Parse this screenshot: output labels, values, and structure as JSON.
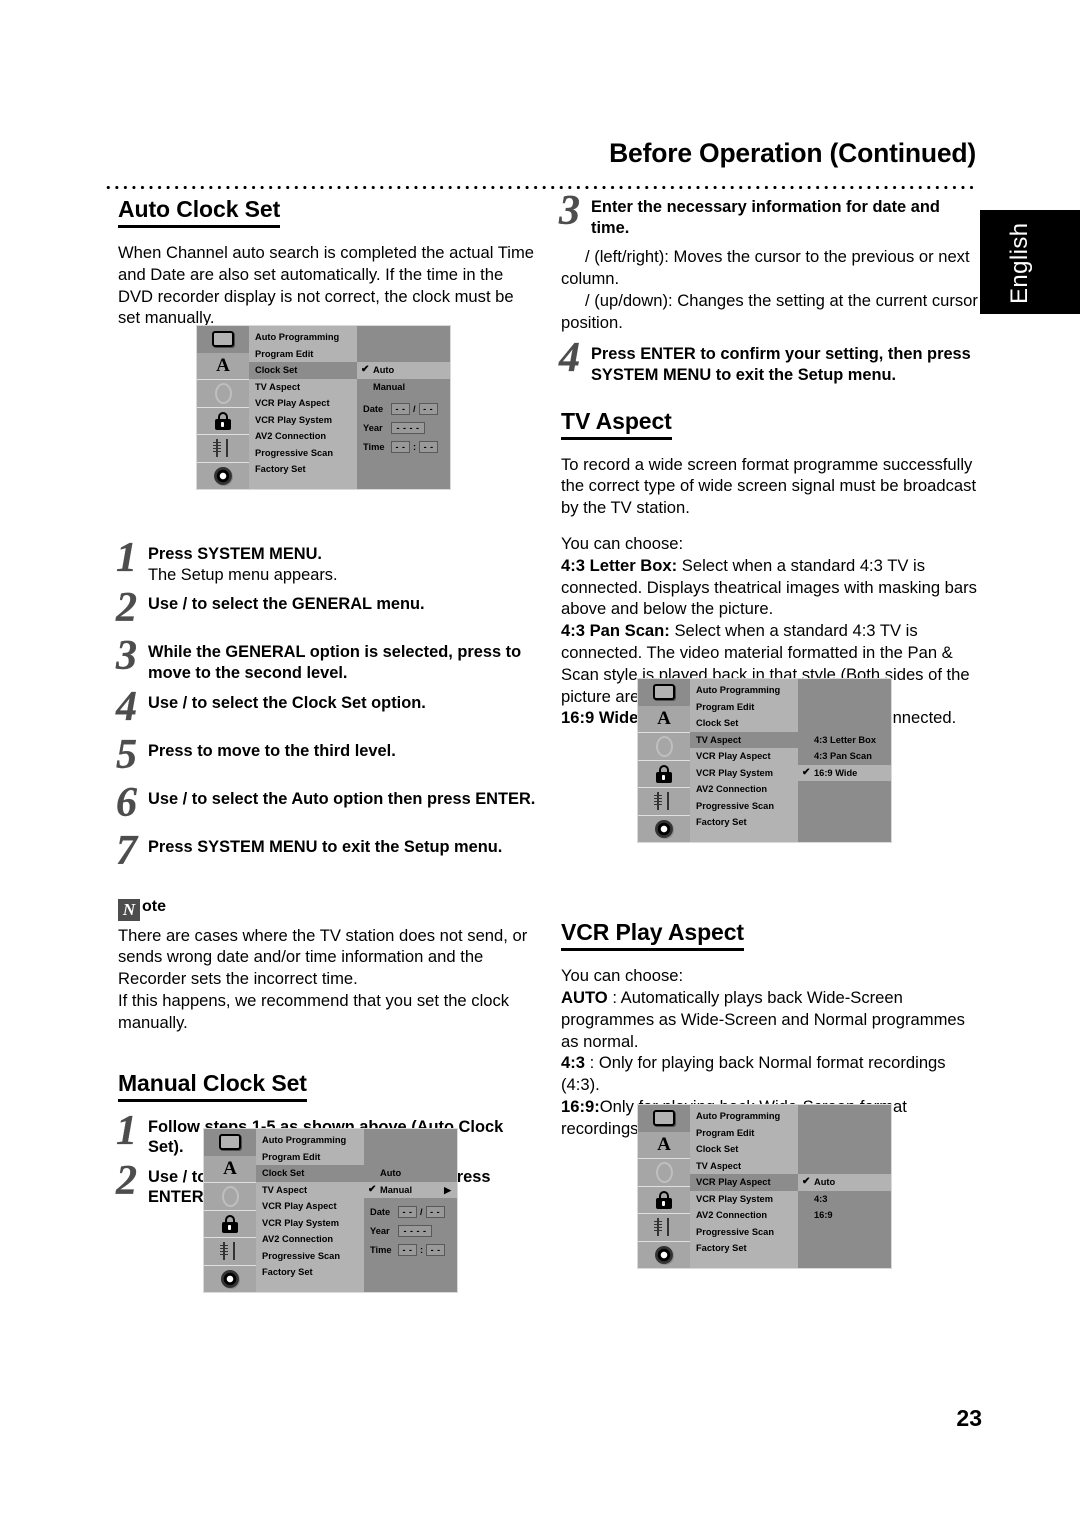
{
  "header": {
    "title": "Before Operation (Continued)",
    "side_tab": "English"
  },
  "page_number": "23",
  "left_column": {
    "auto_clock_set": {
      "heading": "Auto Clock Set",
      "intro": "When Channel auto search is completed the actual Time and Date are also set automatically. If the time in the DVD recorder display is not correct, the clock must be set manually.",
      "steps": [
        {
          "num": "1",
          "bold": "Press SYSTEM MENU.",
          "regular": "The Setup menu appears."
        },
        {
          "num": "2",
          "bold": "Use      /      to select the GENERAL menu.",
          "regular": ""
        },
        {
          "num": "3",
          "bold": "While the GENERAL option is selected, press      to move to the second level.",
          "regular": ""
        },
        {
          "num": "4",
          "bold": "Use      /      to select the Clock Set option.",
          "regular": ""
        },
        {
          "num": "5",
          "bold": "Press       to move to the third level.",
          "regular": ""
        },
        {
          "num": "6",
          "bold": "Use      /      to select the Auto option then press ENTER.",
          "regular": ""
        },
        {
          "num": "7",
          "bold": "Press SYSTEM MENU to exit the Setup menu.",
          "regular": ""
        }
      ]
    },
    "note": {
      "badge": "N",
      "label": "ote",
      "text1": "There are cases where the TV station does not send, or sends wrong date and/or time information and the Recorder sets the incorrect time.",
      "text2": "If this happens, we recommend that you set the clock manually."
    },
    "manual_clock_set": {
      "heading": "Manual Clock Set",
      "steps": [
        {
          "num": "1",
          "bold": "Follow steps 1-5 as shown above (Auto Clock Set).",
          "regular": ""
        },
        {
          "num": "2",
          "bold": "Use      /      to select the Manual option then press ENTER.",
          "regular": ""
        }
      ]
    }
  },
  "right_column": {
    "steps": [
      {
        "num": "3",
        "bold": "Enter the necessary information for date and time.",
        "regular": ""
      },
      {
        "num": "4",
        "bold": "Press ENTER to confirm your setting, then press SYSTEM MENU to exit the Setup menu.",
        "regular": ""
      }
    ],
    "step3_notes": [
      "/      (left/right): Moves the cursor to the previous or next column.",
      "/      (up/down): Changes the setting at the current cursor position."
    ],
    "tv_aspect": {
      "heading": "TV Aspect",
      "intro": "To record a wide screen format programme successfully the correct type of wide screen signal must be broadcast by the TV station.",
      "you_can_choose": "You can choose:",
      "options": [
        {
          "label": "4:3 Letter Box:",
          "desc": " Select when a standard 4:3 TV is connected. Displays theatrical images with masking bars above and below the picture."
        },
        {
          "label": "4:3 Pan Scan:",
          "desc": " Select when a standard 4:3 TV is connected. The video material formatted in the Pan & Scan style is played back in that style (Both sides of the picture are cut off)."
        },
        {
          "label": "16:9 Wide:",
          "desc": " Select when a 16:9 wide TV is connected."
        }
      ]
    },
    "vcr_play_aspect": {
      "heading": "VCR Play Aspect",
      "you_can_choose": "You can choose:",
      "options": [
        {
          "label": "AUTO",
          "desc": " : Automatically plays back Wide-Screen programmes as Wide-Screen and Normal programmes as normal."
        },
        {
          "label": "4:3",
          "desc": " : Only for playing back Normal format recordings (4:3)."
        },
        {
          "label": "16:9:",
          "desc": "Only for playing back Wide-Screen format recordings (16:9)."
        }
      ]
    }
  },
  "osd_common": {
    "icons": [
      "tv-icon",
      "letter-a-icon",
      "ellipse-icon",
      "lock-icon",
      "slider-icon",
      "disc-icon"
    ],
    "menu_items": [
      "Auto Programming",
      "Program Edit",
      "Clock Set",
      "TV Aspect",
      "VCR Play Aspect",
      "VCR Play System",
      "AV2 Connection",
      "Progressive Scan",
      "Factory Set"
    ]
  },
  "osd_auto_clock": {
    "selected_menu": "Clock Set",
    "options": [
      {
        "label": "Auto",
        "checked": true,
        "selected": true
      },
      {
        "label": "Manual",
        "checked": false,
        "selected": false
      }
    ],
    "fields": [
      {
        "label": "Date",
        "v1": "- -",
        "sep": "/",
        "v2": "- -"
      },
      {
        "label": "Year",
        "v1": "- - - -",
        "sep": "",
        "v2": ""
      },
      {
        "label": "Time",
        "v1": "- -",
        "sep": ":",
        "v2": "- -"
      }
    ]
  },
  "osd_manual_clock": {
    "selected_menu": "Clock Set",
    "options": [
      {
        "label": "Auto",
        "checked": false,
        "selected": false
      },
      {
        "label": "Manual",
        "checked": true,
        "selected": true,
        "arrow": true
      }
    ],
    "fields": [
      {
        "label": "Date",
        "v1": "- -",
        "sep": "/",
        "v2": "- -"
      },
      {
        "label": "Year",
        "v1": "- - - -",
        "sep": "",
        "v2": ""
      },
      {
        "label": "Time",
        "v1": "- -",
        "sep": ":",
        "v2": "- -"
      }
    ]
  },
  "osd_tv_aspect": {
    "selected_menu": "TV Aspect",
    "options": [
      {
        "label": "4:3 Letter Box",
        "checked": false,
        "selected": false
      },
      {
        "label": "4:3 Pan Scan",
        "checked": false,
        "selected": false
      },
      {
        "label": "16:9 Wide",
        "checked": true,
        "selected": true
      }
    ]
  },
  "osd_vcr_play_aspect": {
    "selected_menu": "VCR Play Aspect",
    "options": [
      {
        "label": "Auto",
        "checked": true,
        "selected": true
      },
      {
        "label": "4:3",
        "checked": false,
        "selected": false
      },
      {
        "label": "16:9",
        "checked": false,
        "selected": false
      }
    ]
  }
}
